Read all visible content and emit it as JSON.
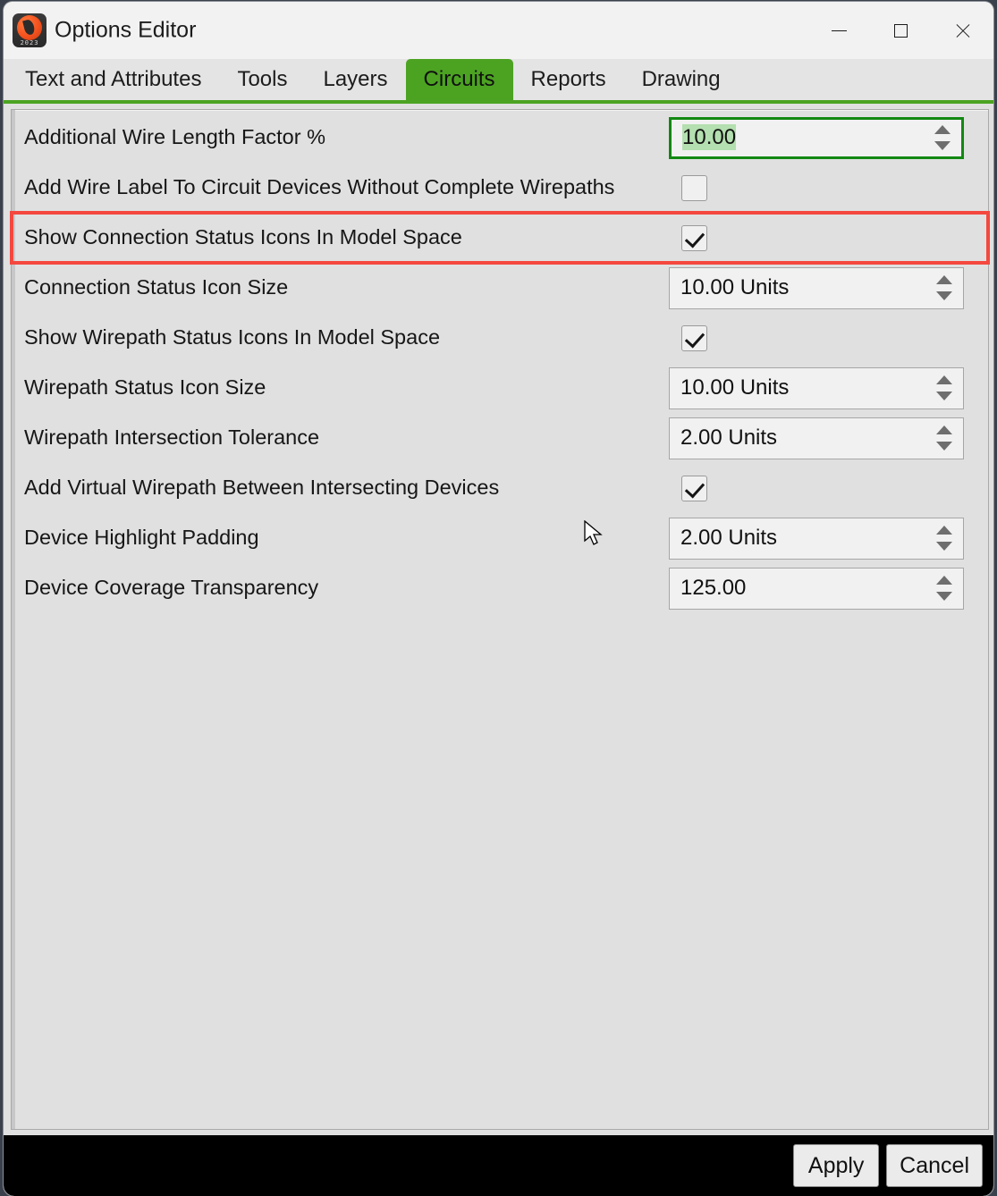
{
  "window": {
    "title": "Options Editor",
    "icon": "app-logo-icon",
    "icon_year": "2023",
    "controls": {
      "minimize": "minimize-icon",
      "maximize": "maximize-icon",
      "close": "close-icon"
    }
  },
  "tabs": [
    {
      "label": "Text and Attributes",
      "active": false
    },
    {
      "label": "Tools",
      "active": false
    },
    {
      "label": "Layers",
      "active": false
    },
    {
      "label": "Circuits",
      "active": true
    },
    {
      "label": "Reports",
      "active": false
    },
    {
      "label": "Drawing",
      "active": false
    }
  ],
  "colors": {
    "accent_green": "#4ca322",
    "focus_green": "#128812",
    "selection_green": "#b4dfb0",
    "highlight_red": "#f4483f",
    "panel_bg": "#e0e0e0",
    "footer_bg": "#000000"
  },
  "options": [
    {
      "label": "Additional Wire Length Factor %",
      "control": "spinner",
      "value": "10.00",
      "selected": true,
      "focused": true,
      "highlighted": false
    },
    {
      "label": "Add Wire Label To Circuit Devices Without Complete Wirepaths",
      "control": "checkbox",
      "checked": false,
      "highlighted": false
    },
    {
      "label": "Show Connection Status Icons In Model Space",
      "control": "checkbox",
      "checked": true,
      "highlighted": true
    },
    {
      "label": "Connection Status Icon Size",
      "control": "spinner",
      "value": "10.00 Units",
      "selected": false,
      "focused": false,
      "highlighted": false
    },
    {
      "label": "Show Wirepath Status Icons In Model Space",
      "control": "checkbox",
      "checked": true,
      "highlighted": false
    },
    {
      "label": "Wirepath Status Icon Size",
      "control": "spinner",
      "value": "10.00 Units",
      "selected": false,
      "focused": false,
      "highlighted": false
    },
    {
      "label": "Wirepath Intersection Tolerance",
      "control": "spinner",
      "value": "2.00 Units",
      "selected": false,
      "focused": false,
      "highlighted": false
    },
    {
      "label": "Add Virtual Wirepath Between Intersecting Devices",
      "control": "checkbox",
      "checked": true,
      "highlighted": false
    },
    {
      "label": "Device Highlight Padding",
      "control": "spinner",
      "value": "2.00 Units",
      "selected": false,
      "focused": false,
      "highlighted": false
    },
    {
      "label": "Device Coverage Transparency",
      "control": "spinner",
      "value": "125.00",
      "selected": false,
      "focused": false,
      "highlighted": false
    }
  ],
  "footer": {
    "apply_label": "Apply",
    "cancel_label": "Cancel"
  }
}
